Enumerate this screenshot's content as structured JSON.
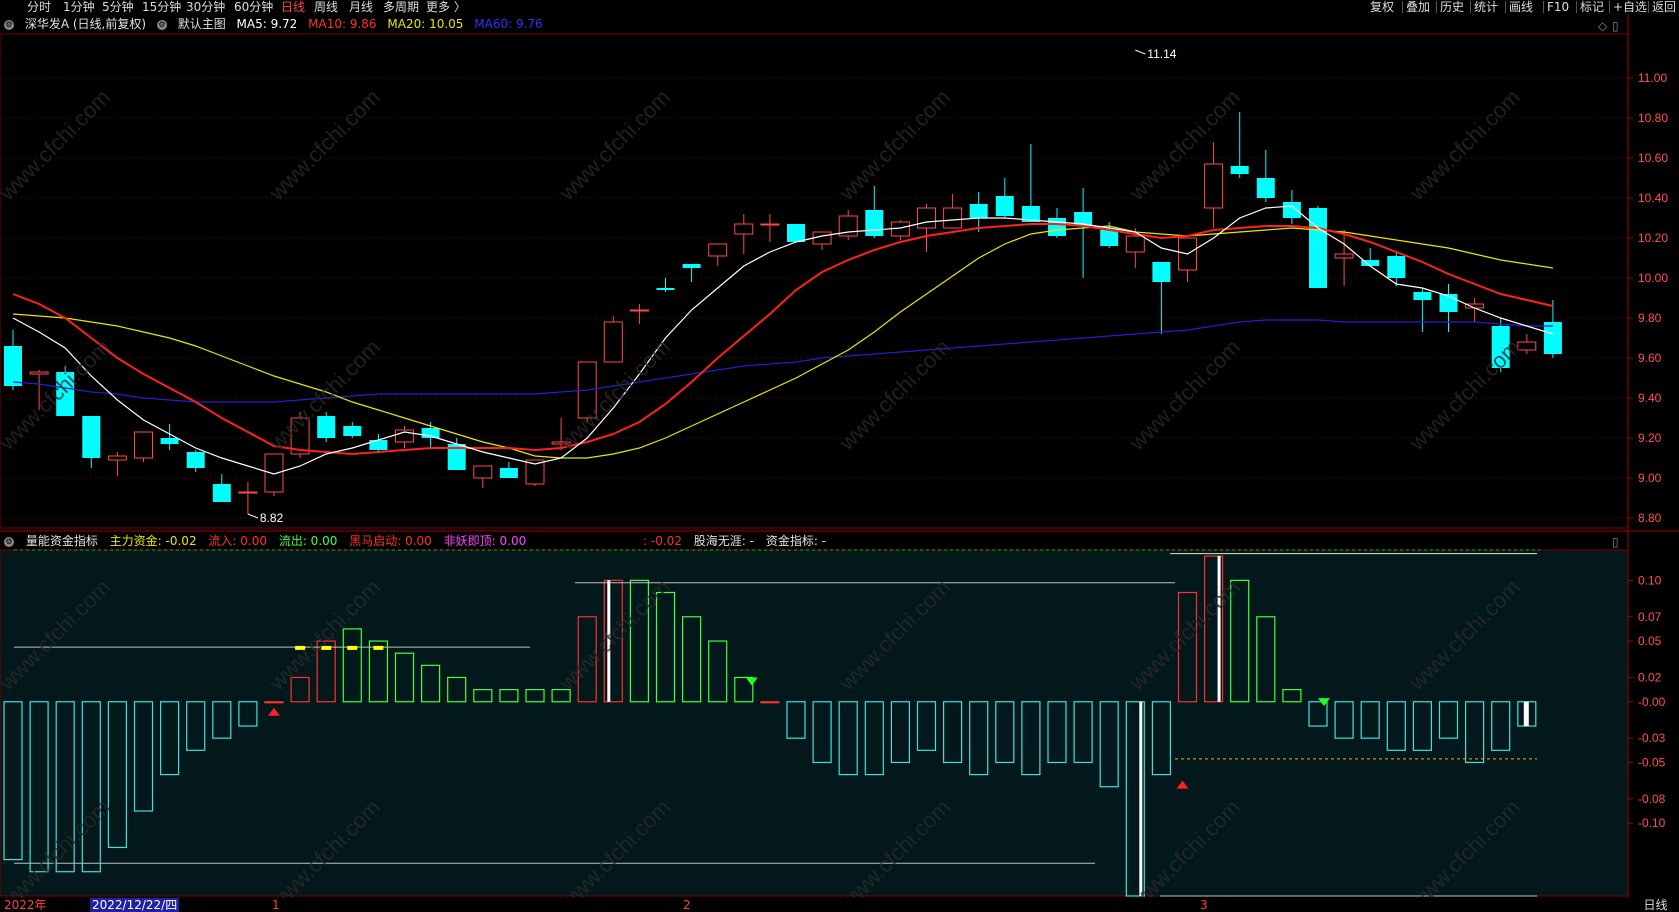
{
  "toolbar": {
    "periods": [
      "分时",
      "1分钟",
      "5分钟",
      "15分钟",
      "30分钟",
      "60分钟",
      "日线",
      "周线",
      "月线",
      "多周期",
      "更多 〉"
    ],
    "active_period": "日线",
    "tools": [
      "复权",
      "叠加",
      "历史",
      "统计",
      "画线",
      "F10",
      "标记",
      "+自选",
      "返回"
    ]
  },
  "main_legend": {
    "stock": "深华发A (日线,前复权)",
    "template": "默认主图",
    "ma5": "MA5: 9.72",
    "ma10": "MA10: 9.86",
    "ma20": "MA20: 10.05",
    "ma60": "MA60: 9.76"
  },
  "indicator_legend": {
    "name": "量能资金指标",
    "main_fund": "主力资金: -0.02",
    "inflow": "流入: 0.00",
    "outflow": "流出: 0.00",
    "black_horse": "黑马启动: 0.00",
    "hit_top": "非妖即顶: 0.00",
    "extra1": ": -0.02",
    "extra2": "股海无涯: -",
    "extra3": "资金指标: -"
  },
  "colors": {
    "up": "#ff4a4a",
    "down": "#00ffff",
    "ma5": "#ffffff",
    "ma10": "#ff2020",
    "ma20": "#e8e800",
    "ma60": "#2020d0",
    "grid": "#4a0000",
    "axis_text": "#ff5050",
    "in_bar": "#ff3030",
    "out_bar": "#40ff40",
    "neg_bar": "#40e0e0"
  },
  "chart_data": [
    {
      "type": "candlestick",
      "title": "深华发A (日线,前复权)",
      "y_ticks": [
        "11.00",
        "10.80",
        "10.60",
        "10.40",
        "10.20",
        "10.00",
        "9.80",
        "9.60",
        "9.40",
        "9.20",
        "9.00",
        "8.80"
      ],
      "ylim": [
        8.75,
        11.22
      ],
      "annotations": [
        {
          "label": "11.14",
          "value": 11.14,
          "index": 43
        },
        {
          "label": "8.82",
          "value": 8.82,
          "index": 9
        }
      ],
      "candles": [
        [
          9.66,
          9.74,
          9.44,
          9.46
        ],
        [
          9.52,
          9.54,
          9.34,
          9.53
        ],
        [
          9.53,
          9.56,
          9.34,
          9.31
        ],
        [
          9.31,
          9.31,
          9.05,
          9.1
        ],
        [
          9.09,
          9.13,
          9.01,
          9.11
        ],
        [
          9.1,
          9.21,
          9.08,
          9.23
        ],
        [
          9.2,
          9.27,
          9.14,
          9.17
        ],
        [
          9.13,
          9.14,
          9.03,
          9.05
        ],
        [
          8.97,
          9.02,
          8.9,
          8.88
        ],
        [
          8.93,
          8.98,
          8.82,
          8.93
        ],
        [
          8.93,
          9.12,
          8.91,
          9.12
        ],
        [
          9.12,
          9.33,
          9.1,
          9.3
        ],
        [
          9.31,
          9.33,
          9.18,
          9.2
        ],
        [
          9.26,
          9.28,
          9.2,
          9.21
        ],
        [
          9.19,
          9.22,
          9.13,
          9.14
        ],
        [
          9.18,
          9.26,
          9.15,
          9.24
        ],
        [
          9.25,
          9.28,
          9.15,
          9.2
        ],
        [
          9.17,
          9.2,
          9.06,
          9.04
        ],
        [
          9.0,
          9.06,
          8.95,
          9.06
        ],
        [
          9.05,
          9.08,
          9.0,
          9.0
        ],
        [
          8.97,
          9.09,
          8.96,
          9.09
        ],
        [
          9.17,
          9.3,
          9.14,
          9.18
        ],
        [
          9.3,
          9.47,
          9.28,
          9.58
        ],
        [
          9.58,
          9.81,
          9.58,
          9.78
        ],
        [
          9.84,
          9.87,
          9.77,
          9.84
        ],
        [
          9.95,
          10.0,
          9.93,
          9.94
        ],
        [
          10.07,
          10.07,
          9.98,
          10.05
        ],
        [
          10.11,
          10.11,
          10.06,
          10.17
        ],
        [
          10.22,
          10.32,
          10.12,
          10.27
        ],
        [
          10.27,
          10.32,
          10.18,
          10.27
        ],
        [
          10.27,
          10.27,
          10.18,
          10.18
        ],
        [
          10.17,
          10.18,
          10.14,
          10.23
        ],
        [
          10.21,
          10.34,
          10.19,
          10.31
        ],
        [
          10.34,
          10.46,
          10.2,
          10.21
        ],
        [
          10.21,
          10.29,
          10.19,
          10.28
        ],
        [
          10.25,
          10.37,
          10.13,
          10.35
        ],
        [
          10.25,
          10.42,
          10.26,
          10.35
        ],
        [
          10.37,
          10.43,
          10.23,
          10.3
        ],
        [
          10.41,
          10.5,
          10.3,
          10.31
        ],
        [
          10.36,
          10.67,
          10.33,
          10.28
        ],
        [
          10.3,
          10.35,
          10.2,
          10.21
        ],
        [
          10.33,
          10.45,
          10.0,
          10.26
        ],
        [
          10.24,
          10.28,
          10.15,
          10.16
        ],
        [
          10.13,
          10.25,
          10.05,
          10.21
        ],
        [
          10.08,
          10.07,
          9.72,
          9.98
        ],
        [
          10.04,
          10.19,
          9.98,
          10.2
        ],
        [
          10.35,
          10.68,
          10.25,
          10.57
        ],
        [
          10.56,
          10.83,
          10.5,
          10.52
        ],
        [
          10.5,
          10.64,
          10.38,
          10.4
        ],
        [
          10.38,
          10.44,
          10.27,
          10.3
        ],
        [
          10.35,
          10.36,
          9.96,
          9.95
        ],
        [
          10.1,
          10.24,
          9.96,
          10.12
        ],
        [
          10.09,
          10.15,
          10.06,
          10.06
        ],
        [
          10.11,
          10.13,
          9.96,
          10.0
        ],
        [
          9.93,
          9.95,
          9.73,
          9.89
        ],
        [
          9.92,
          9.97,
          9.73,
          9.83
        ],
        [
          9.85,
          9.9,
          9.78,
          9.87
        ],
        [
          9.76,
          9.8,
          9.53,
          9.55
        ],
        [
          9.64,
          9.72,
          9.62,
          9.68
        ],
        [
          9.78,
          9.89,
          9.6,
          9.62
        ]
      ],
      "ma5": [
        9.8,
        9.73,
        9.65,
        9.51,
        9.39,
        9.29,
        9.22,
        9.15,
        9.1,
        9.06,
        9.02,
        9.06,
        9.12,
        9.15,
        9.19,
        9.23,
        9.21,
        9.17,
        9.13,
        9.1,
        9.07,
        9.1,
        9.2,
        9.35,
        9.52,
        9.7,
        9.84,
        9.95,
        10.06,
        10.13,
        10.18,
        10.21,
        10.23,
        10.24,
        10.25,
        10.28,
        10.29,
        10.3,
        10.3,
        10.29,
        10.28,
        10.27,
        10.25,
        10.23,
        10.15,
        10.12,
        10.2,
        10.3,
        10.35,
        10.36,
        10.25,
        10.17,
        10.06,
        9.97,
        9.95,
        9.91,
        9.85,
        9.8,
        9.76,
        9.72
      ],
      "ma10": [
        9.92,
        9.87,
        9.8,
        9.7,
        9.6,
        9.52,
        9.45,
        9.38,
        9.3,
        9.23,
        9.16,
        9.14,
        9.13,
        9.12,
        9.13,
        9.14,
        9.15,
        9.15,
        9.15,
        9.15,
        9.14,
        9.15,
        9.18,
        9.22,
        9.28,
        9.37,
        9.48,
        9.6,
        9.71,
        9.82,
        9.94,
        10.03,
        10.09,
        10.14,
        10.18,
        10.21,
        10.23,
        10.25,
        10.26,
        10.27,
        10.27,
        10.26,
        10.24,
        10.22,
        10.2,
        10.21,
        10.24,
        10.25,
        10.26,
        10.26,
        10.25,
        10.22,
        10.18,
        10.13,
        10.08,
        10.02,
        9.97,
        9.92,
        9.89,
        9.86
      ],
      "ma20": [
        9.82,
        9.81,
        9.8,
        9.78,
        9.76,
        9.73,
        9.7,
        9.66,
        9.61,
        9.56,
        9.51,
        9.47,
        9.43,
        9.38,
        9.34,
        9.3,
        9.26,
        9.22,
        9.18,
        9.15,
        9.11,
        9.1,
        9.1,
        9.12,
        9.15,
        9.2,
        9.26,
        9.32,
        9.38,
        9.44,
        9.5,
        9.57,
        9.64,
        9.73,
        9.83,
        9.92,
        10.01,
        10.1,
        10.17,
        10.22,
        10.24,
        10.25,
        10.26,
        10.23,
        10.22,
        10.21,
        10.22,
        10.23,
        10.24,
        10.25,
        10.24,
        10.23,
        10.21,
        10.19,
        10.17,
        10.15,
        10.12,
        10.09,
        10.07,
        10.05
      ],
      "ma60": [
        9.48,
        9.47,
        9.45,
        9.43,
        9.42,
        9.4,
        9.39,
        9.38,
        9.38,
        9.38,
        9.38,
        9.39,
        9.4,
        9.41,
        9.42,
        9.42,
        9.42,
        9.42,
        9.42,
        9.42,
        9.42,
        9.43,
        9.44,
        9.46,
        9.48,
        9.5,
        9.52,
        9.54,
        9.56,
        9.57,
        9.58,
        9.6,
        9.61,
        9.62,
        9.63,
        9.64,
        9.65,
        9.66,
        9.67,
        9.68,
        9.69,
        9.7,
        9.71,
        9.72,
        9.73,
        9.74,
        9.76,
        9.78,
        9.79,
        9.79,
        9.79,
        9.78,
        9.78,
        9.78,
        9.78,
        9.78,
        9.78,
        9.77,
        9.76,
        9.76
      ]
    },
    {
      "type": "bar",
      "title": "量能资金指标",
      "y_ticks": [
        "0.10",
        "0.07",
        "0.05",
        "0.02",
        "-0.00",
        "-0.03",
        "-0.05",
        "-0.08",
        "-0.10"
      ],
      "ylim": [
        -0.16,
        0.125
      ],
      "values": [
        -0.13,
        -0.14,
        -0.14,
        -0.14,
        -0.12,
        -0.09,
        -0.06,
        -0.04,
        -0.03,
        -0.02,
        0.0,
        0.02,
        0.05,
        0.06,
        0.05,
        0.04,
        0.03,
        0.02,
        0.01,
        0.01,
        0.01,
        0.01,
        0.07,
        0.1,
        0.1,
        0.09,
        0.07,
        0.05,
        0.02,
        0.0,
        -0.03,
        -0.05,
        -0.06,
        -0.06,
        -0.05,
        -0.04,
        -0.05,
        -0.06,
        -0.05,
        -0.06,
        -0.05,
        -0.05,
        -0.07,
        -0.16,
        -0.06,
        0.09,
        0.12,
        0.1,
        0.07,
        0.01,
        -0.02,
        -0.03,
        -0.03,
        -0.04,
        -0.04,
        -0.03,
        -0.05,
        -0.04,
        -0.02
      ]
    }
  ],
  "bottom_axis": {
    "year": "2022年",
    "cursor_date": "2022/12/22/四",
    "months": [
      "1",
      "2",
      "3"
    ],
    "period_label": "日线"
  }
}
